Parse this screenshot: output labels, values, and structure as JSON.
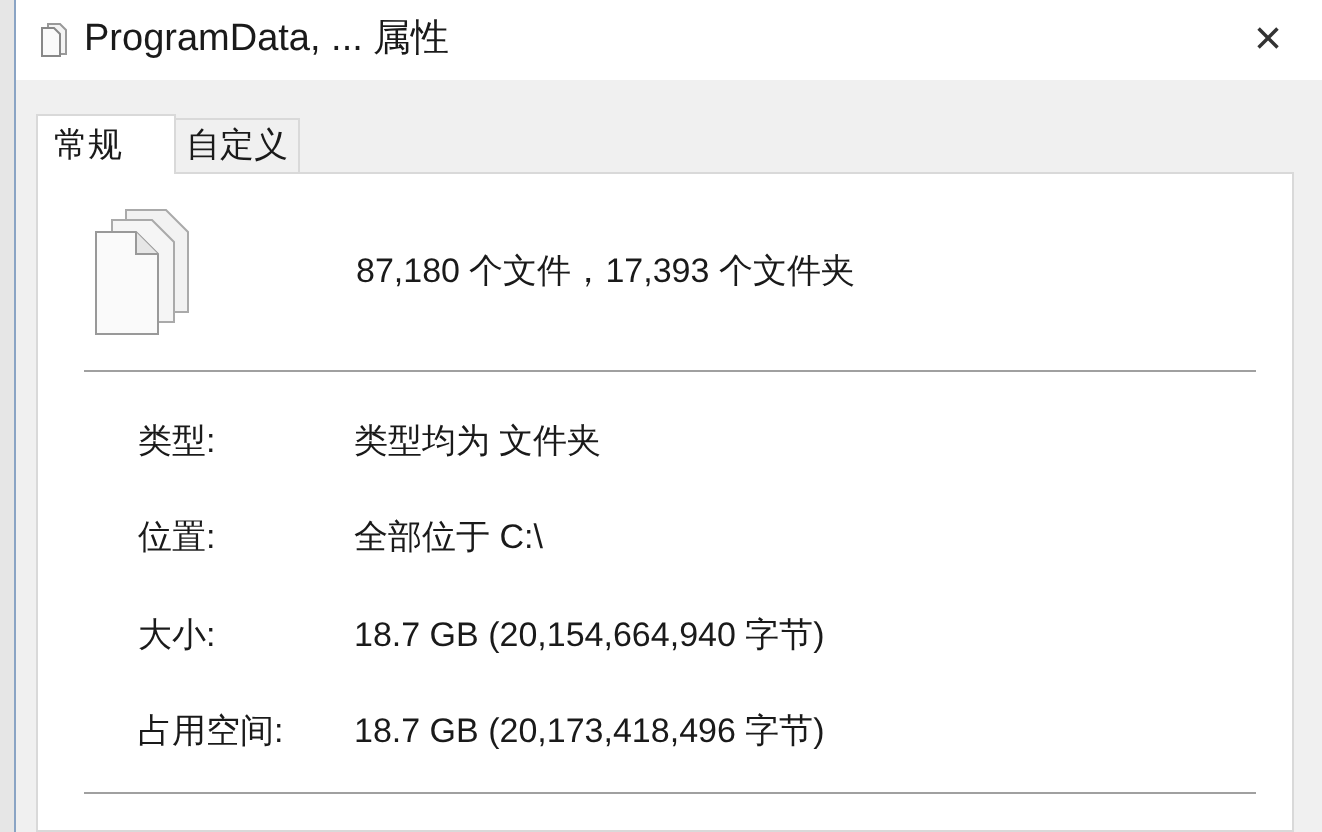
{
  "window": {
    "title": "ProgramData, ... 属性",
    "close": "×"
  },
  "tabs": [
    {
      "label": "常规",
      "selected": true
    },
    {
      "label": "自定义",
      "selected": false
    }
  ],
  "summary": "87,180 个文件，17,393 个文件夹",
  "properties": [
    {
      "label": "类型:",
      "value": "类型均为 文件夹"
    },
    {
      "label": "位置:",
      "value": "全部位于 C:\\"
    },
    {
      "label": "大小:",
      "value": "18.7 GB (20,154,664,940 字节)"
    },
    {
      "label": "占用空间:",
      "value": "18.7 GB (20,173,418,496 字节)"
    }
  ]
}
